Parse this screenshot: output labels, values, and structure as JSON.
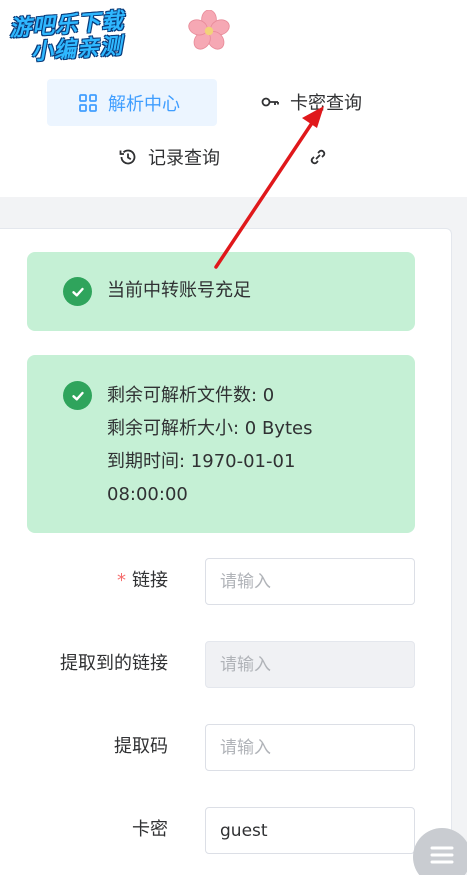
{
  "watermark": {
    "line1": "游吧乐下载",
    "line2": "小编亲测"
  },
  "nav": {
    "parse_center": "解析中心",
    "card_query": "卡密查询",
    "record_query": "记录查询"
  },
  "alerts": {
    "account_status": "当前中转账号充足",
    "remaining_files": "剩余可解析文件数: 0",
    "remaining_size": "剩余可解析大小: 0 Bytes",
    "expire_label": "到期时间: 1970-01-01",
    "expire_time": "08:00:00"
  },
  "form": {
    "link_label": "链接",
    "link_placeholder": "请输入",
    "extracted_label": "提取到的链接",
    "extracted_placeholder": "请输入",
    "code_label": "提取码",
    "code_placeholder": "请输入",
    "card_label": "卡密",
    "card_value": "guest"
  },
  "colors": {
    "accent": "#409eff",
    "success_bg": "#c5f0d5",
    "success_icon": "#2fa45c",
    "required": "#f56c6c",
    "annotation_arrow": "#e0181b"
  }
}
